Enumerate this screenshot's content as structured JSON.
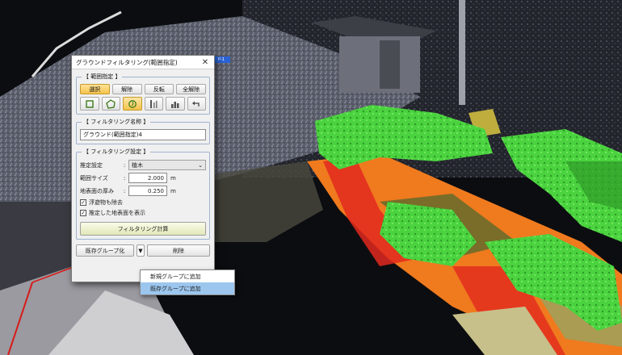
{
  "dialog": {
    "title": "グラウンドフィルタリング(範囲指定)",
    "close": "✕"
  },
  "range_group": {
    "legend": "【 範囲指定 】",
    "buttons": [
      "選択",
      "解除",
      "反転",
      "全解除"
    ],
    "icon_buttons": [
      "rectangle-select-icon",
      "polygon-select-icon",
      "lasso-select-icon",
      "vertical-section-icon",
      "height-select-icon",
      "undo-icon"
    ]
  },
  "name_group": {
    "legend": "【 フィルタリング名称 】",
    "value": "グラウンド(範囲指定)4"
  },
  "settings_group": {
    "legend": "【 フィルタリング設定 】",
    "estimate_label": "推定設定",
    "estimate_value": "植木",
    "range_label": "範囲サイズ",
    "range_value": "2.000",
    "range_unit": "m",
    "thickness_label": "地表面の厚み",
    "thickness_value": "0.250",
    "thickness_unit": "m",
    "colon": ":",
    "check_floating": "浮遊物も除去",
    "check_show_surface": "推定した地表面を表示",
    "compute_button": "フィルタリング計算"
  },
  "footer": {
    "existing_group_button": "既存グループ化",
    "dropdown_arrow": "▼",
    "delete_button": "削除"
  },
  "dropdown": {
    "items": [
      "新規グループに追加",
      "既存グループに追加"
    ]
  },
  "colors": {
    "ground_green": "#4bd33f",
    "orange": "#f07a1e",
    "red": "#e2291e",
    "olive": "#6b6b2a"
  }
}
